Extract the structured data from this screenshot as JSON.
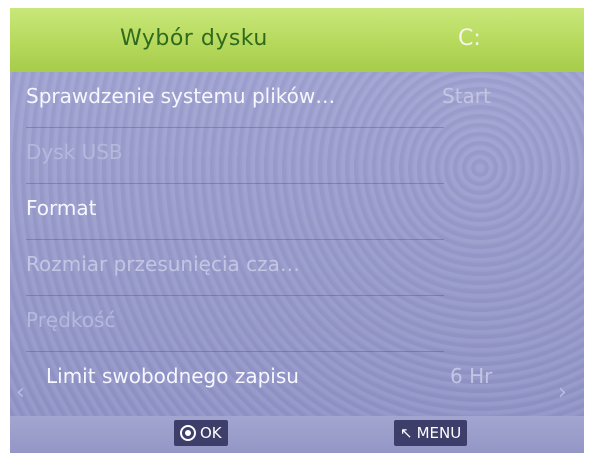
{
  "header": {
    "title": "Wybór dysku",
    "drive": "C:"
  },
  "menu": {
    "items": [
      {
        "label": "Sprawdzenie systemu plików…",
        "value": "Start"
      },
      {
        "label": "Dysk USB",
        "value": ""
      },
      {
        "label": "Format",
        "value": ""
      },
      {
        "label": "Rozmiar przesunięcia cza…",
        "value": ""
      },
      {
        "label": "Prędkość",
        "value": ""
      },
      {
        "label": "Limit swobodnego zapisu",
        "value": "6 Hr"
      }
    ],
    "left_arrow": "‹",
    "right_arrow": "›"
  },
  "footer": {
    "ok_label": "OK",
    "menu_label": "MENU",
    "ok_icon": "ok-circle-icon",
    "menu_icon": "back-arrow-icon"
  },
  "colors": {
    "header_bg": "#b6d95c",
    "header_title": "#2f6a1e",
    "screen_bg": "#9a9dcd",
    "button_bg": "#3d3e6a"
  }
}
